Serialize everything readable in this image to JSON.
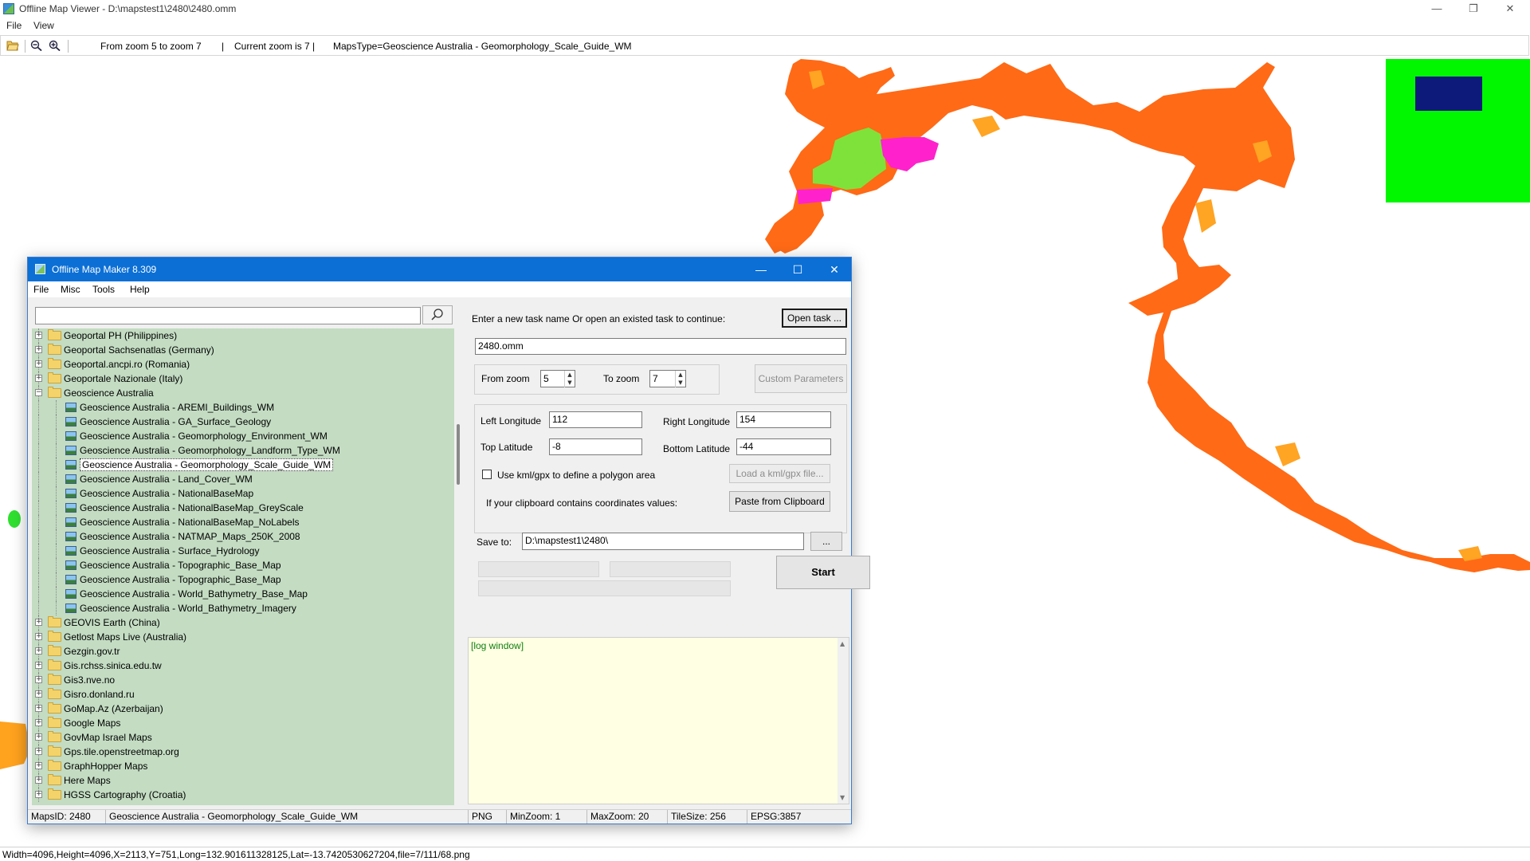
{
  "viewer": {
    "title": "Offline Map Viewer - D:\\mapstest1\\2480\\2480.omm",
    "window_buttons": {
      "minimize": "—",
      "restore": "❐",
      "close": "✕"
    },
    "menu": [
      "File",
      "View"
    ],
    "toolbar": {
      "zoom_range": "From zoom 5 to zoom 7",
      "separator": "|",
      "current_zoom": "Current zoom is 7 |",
      "maps_type": "MapsType=Geoscience Australia - Geomorphology_Scale_Guide_WM"
    },
    "status": "Width=4096,Height=4096,X=2113,Y=751,Long=132.901611328125,Lat=-13.7420530627204,file=7/111/68.png",
    "map_colors": {
      "land": "#ff6a16",
      "highlight": "#ffa423",
      "green": "#7fe23a",
      "magenta": "#ff22cc",
      "overview_green": "#00f700",
      "overview_box": "#0d1a7a"
    }
  },
  "maker": {
    "title": "Offline Map Maker 8.309",
    "window_buttons": {
      "minimize": "—",
      "maximize": "☐",
      "close": "✕"
    },
    "menu": [
      "File",
      "Misc",
      "Tools",
      "Help"
    ],
    "search": {
      "value": ""
    },
    "tree": [
      {
        "label": "Geoportal PH (Philippines)",
        "level": 0,
        "expanded": false
      },
      {
        "label": "Geoportal Sachsenatlas (Germany)",
        "level": 0,
        "expanded": false
      },
      {
        "label": "Geoportal.ancpi.ro (Romania)",
        "level": 0,
        "expanded": false
      },
      {
        "label": "Geoportale Nazionale (Italy)",
        "level": 0,
        "expanded": false
      },
      {
        "label": "Geoscience Australia",
        "level": 0,
        "expanded": true
      },
      {
        "label": "Geoscience Australia - AREMI_Buildings_WM",
        "level": 1
      },
      {
        "label": "Geoscience Australia - GA_Surface_Geology",
        "level": 1
      },
      {
        "label": "Geoscience Australia - Geomorphology_Environment_WM",
        "level": 1
      },
      {
        "label": "Geoscience Australia - Geomorphology_Landform_Type_WM",
        "level": 1
      },
      {
        "label": "Geoscience Australia - Geomorphology_Scale_Guide_WM",
        "level": 1,
        "selected": true
      },
      {
        "label": "Geoscience Australia - Land_Cover_WM",
        "level": 1
      },
      {
        "label": "Geoscience Australia - NationalBaseMap",
        "level": 1
      },
      {
        "label": "Geoscience Australia - NationalBaseMap_GreyScale",
        "level": 1
      },
      {
        "label": "Geoscience Australia - NationalBaseMap_NoLabels",
        "level": 1
      },
      {
        "label": "Geoscience Australia - NATMAP_Maps_250K_2008",
        "level": 1
      },
      {
        "label": "Geoscience Australia - Surface_Hydrology",
        "level": 1
      },
      {
        "label": "Geoscience Australia - Topographic_Base_Map",
        "level": 1
      },
      {
        "label": "Geoscience Australia - Topographic_Base_Map",
        "level": 1
      },
      {
        "label": "Geoscience Australia - World_Bathymetry_Base_Map",
        "level": 1
      },
      {
        "label": "Geoscience Australia - World_Bathymetry_Imagery",
        "level": 1
      },
      {
        "label": "GEOVIS Earth (China)",
        "level": 0,
        "expanded": false
      },
      {
        "label": "Getlost Maps Live (Australia)",
        "level": 0,
        "expanded": false
      },
      {
        "label": "Gezgin.gov.tr",
        "level": 0,
        "expanded": false
      },
      {
        "label": "Gis.rchss.sinica.edu.tw",
        "level": 0,
        "expanded": false
      },
      {
        "label": "Gis3.nve.no",
        "level": 0,
        "expanded": false
      },
      {
        "label": "Gisro.donland.ru",
        "level": 0,
        "expanded": false
      },
      {
        "label": "GoMap.Az (Azerbaijan)",
        "level": 0,
        "expanded": false
      },
      {
        "label": "Google Maps",
        "level": 0,
        "expanded": false
      },
      {
        "label": "GovMap Israel Maps",
        "level": 0,
        "expanded": false
      },
      {
        "label": "Gps.tile.openstreetmap.org",
        "level": 0,
        "expanded": false
      },
      {
        "label": "GraphHopper Maps",
        "level": 0,
        "expanded": false
      },
      {
        "label": "Here Maps",
        "level": 0,
        "expanded": false
      },
      {
        "label": "HGSS Cartography (Croatia)",
        "level": 0,
        "expanded": false
      }
    ],
    "task": {
      "prompt": "Enter a new task name Or open an existed task to continue:",
      "open_button": "Open task ...",
      "task_name": "2480.omm"
    },
    "zoom": {
      "from_label": "From zoom",
      "from_value": "5",
      "to_label": "To zoom",
      "to_value": "7",
      "custom_button": "Custom Parameters"
    },
    "bounds": {
      "left_label": "Left Longitude",
      "left_value": "112",
      "right_label": "Right Longitude",
      "right_value": "154",
      "top_label": "Top Latitude",
      "top_value": "-8",
      "bottom_label": "Bottom Latitude",
      "bottom_value": "-44",
      "kml_checkbox": "Use kml/gpx to define a polygon area",
      "kml_button": "Load a kml/gpx file...",
      "clipboard_label": "If your clipboard contains coordinates values:",
      "clipboard_button": "Paste from Clipboard"
    },
    "save": {
      "label": "Save to:",
      "path": "D:\\mapstest1\\2480\\",
      "browse": "..."
    },
    "start_button": "Start",
    "log": "[log window]",
    "status": {
      "maps_id": "MapsID: 2480",
      "maps_name": "Geoscience Australia - Geomorphology_Scale_Guide_WM",
      "format": "PNG",
      "min_zoom": "MinZoom: 1",
      "max_zoom": "MaxZoom: 20",
      "tile_size": "TileSize: 256",
      "epsg": "EPSG:3857"
    }
  }
}
